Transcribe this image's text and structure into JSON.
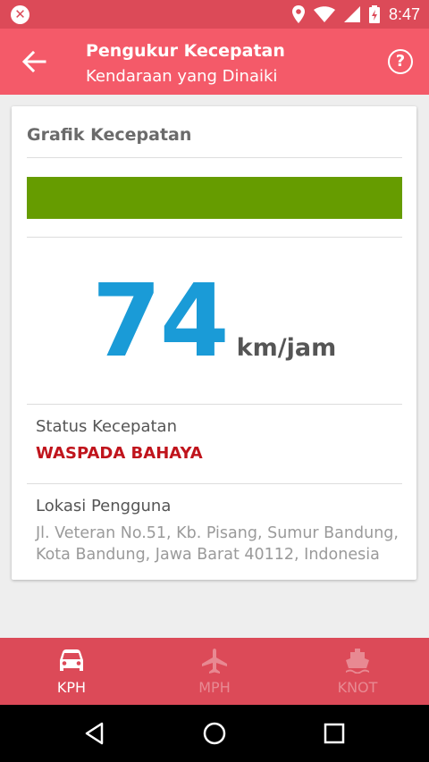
{
  "statusbar": {
    "time": "8:47"
  },
  "appbar": {
    "title": "Pengukur Kecepatan",
    "subtitle": "Kendaraan yang Dinaiki",
    "help_symbol": "?"
  },
  "card": {
    "heading": "Grafik Kecepatan",
    "speed_bar_fraction": 1.0,
    "speed_bar_color": "#669c00",
    "speed_value": "74",
    "speed_unit": "km/jam",
    "status_label": "Status Kecepatan",
    "status_value": "WASPADA BAHAYA",
    "location_label": "Lokasi Pengguna",
    "location_value": "Jl. Veteran No.51, Kb. Pisang, Sumur Bandung, Kota Bandung, Jawa Barat 40112, Indonesia"
  },
  "bottom_nav": {
    "items": [
      {
        "label": "KPH",
        "icon": "car-icon",
        "active": true
      },
      {
        "label": "MPH",
        "icon": "airplane-icon",
        "active": false
      },
      {
        "label": "KNOT",
        "icon": "ship-icon",
        "active": false
      }
    ]
  },
  "colors": {
    "appbar": "#f45a69",
    "statusbar": "#dc4a58",
    "speed": "#1a9bd7",
    "danger": "#c0141c"
  }
}
